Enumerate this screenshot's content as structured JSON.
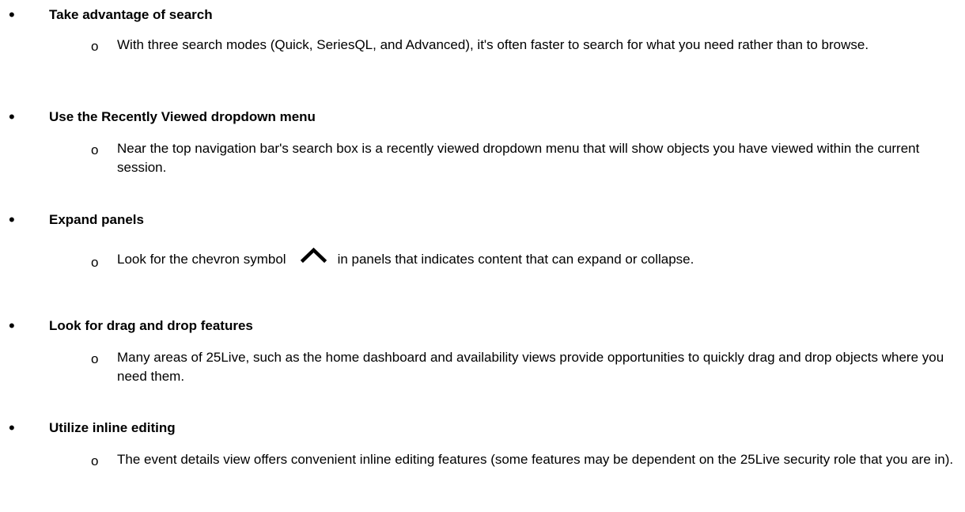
{
  "tips": [
    {
      "heading": "Take advantage of search",
      "text": "With three search modes (Quick, SeriesQL, and Advanced), it's often faster to search for what you need rather than to browse."
    },
    {
      "heading": "Use the Recently Viewed dropdown menu",
      "text": "Near the top navigation bar's search box is a recently viewed dropdown menu that will show objects you have viewed within the current session."
    },
    {
      "heading": "Expand panels",
      "text_before": "Look for the chevron symbol",
      "text_after": "in panels that indicates content that can expand or collapse.",
      "icon": "chevron-up-icon"
    },
    {
      "heading": "Look for drag and drop features",
      "text": "Many areas of 25Live, such as the home dashboard and availability views provide opportunities to quickly drag and drop objects where you need them."
    },
    {
      "heading": "Utilize inline editing",
      "text": "The event details view offers convenient inline editing features (some features may be dependent on the 25Live security role that you are in)."
    }
  ],
  "symbols": {
    "bullet": "•",
    "sub_bullet": "o"
  }
}
